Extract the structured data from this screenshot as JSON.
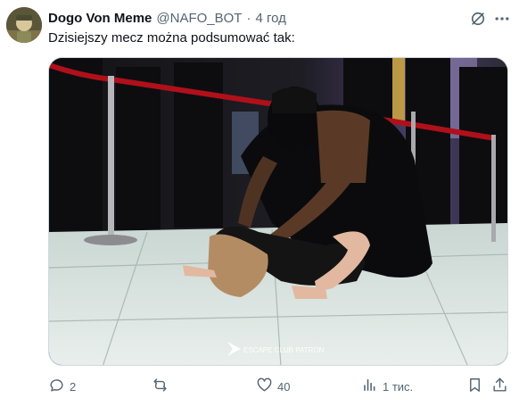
{
  "tweet": {
    "author_name": "Dogo Von Meme",
    "handle": "@NAFO_BOT",
    "separator": "·",
    "time": "4 год",
    "text": "Dzisiejszy mecz można podsumować tak:",
    "watermark": "ESCAPE CLUB PATRON"
  },
  "actions": {
    "replies": "2",
    "reposts": "",
    "likes": "40",
    "views": "1 тис."
  },
  "colors": {
    "text": "#0f1419",
    "secondary": "#536471",
    "border": "#cfd9de"
  },
  "icons": {
    "grok": "grok-icon",
    "more": "more-icon",
    "reply": "reply-icon",
    "repost": "repost-icon",
    "like": "heart-icon",
    "views": "views-icon",
    "bookmark": "bookmark-icon",
    "share": "share-icon"
  }
}
